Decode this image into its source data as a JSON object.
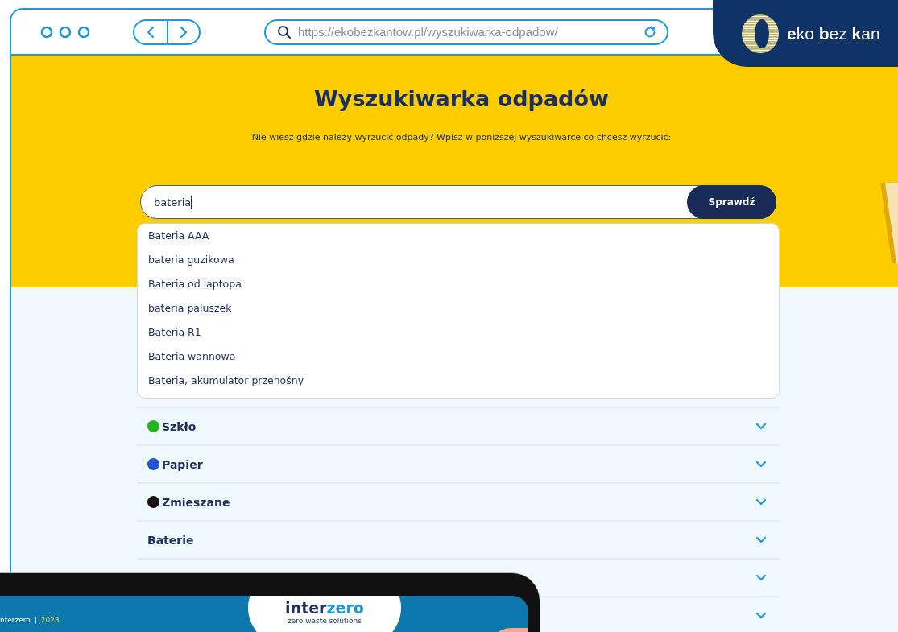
{
  "browser": {
    "url": "https://ekobezkantow.pl/wyszukiwarka-odpadow/"
  },
  "brand_badge": {
    "text": "**e**ko **b**ez **k**an"
  },
  "page": {
    "title": "Wyszukiwarka odpadów",
    "subtitle": "Nie wiesz gdzie należy wyrzucić odpady? Wpisz w poniższej wyszukiwarce co chcesz wyrzucić:"
  },
  "search": {
    "value": "bateria",
    "button": "Sprawdź"
  },
  "suggestions": [
    "Bateria AAA",
    "bateria guzikowa",
    "Bateria od laptopa",
    "bateria paluszek",
    "Bateria R1",
    "Bateria wannowa",
    "Bateria, akumulator przenośny"
  ],
  "categories": [
    {
      "kind": "dot",
      "label": "Szkło",
      "color": "#22b522"
    },
    {
      "kind": "dot",
      "label": "Papier",
      "color": "#1f56d6"
    },
    {
      "kind": "dot",
      "label": "Zmieszane",
      "color": "#111111"
    },
    {
      "kind": "plain",
      "label": "Baterie"
    },
    {
      "kind": "covered"
    },
    {
      "kind": "covered"
    }
  ],
  "tablet": {
    "footer_brand": "nterzero",
    "separator": "|",
    "year": "2023",
    "logo_parts": [
      "inter",
      "zero"
    ],
    "tagline": "zero waste solutions"
  }
}
